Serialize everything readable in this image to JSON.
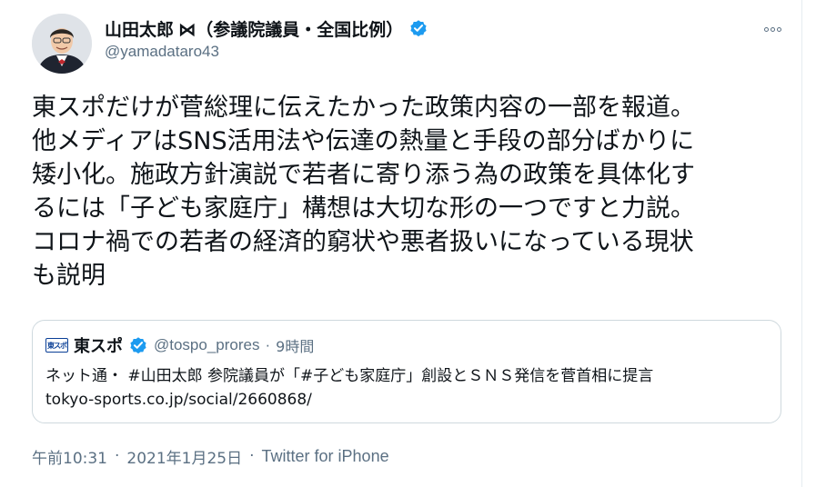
{
  "author": {
    "display_name": "山田太郎 ⋈（参議院議員・全国比例）",
    "handle": "@yamadataro43",
    "verified_icon": "verified-badge-icon",
    "avatar": "avatar-photo"
  },
  "menu": {
    "more_icon": "more-options-icon"
  },
  "tweet": {
    "lines": [
      "東スポだけが菅総理に伝えたかった政策内容の一部を報道。",
      "他メディアはSNS活用法や伝達の熱量と手段の部分ばかりに",
      "矮小化。施政方針演説で若者に寄り添う為の政策を具体化す",
      "るには「子ども家庭庁」構想は大切な形の一つですと力説。",
      "コロナ禍での若者の経済的窮状や悪者扱いになっている現状",
      "も説明"
    ]
  },
  "quote": {
    "logo_text": "東スポ",
    "name": "東スポ",
    "handle": "@tospo_prores",
    "separator": "·",
    "time": "9時間",
    "text_line1": "ネット通・ #山田太郎 参院議員が「#子ども家庭庁」創設とＳＮＳ発信を菅首相に提言",
    "text_line2": "tokyo-sports.co.jp/social/2660868/"
  },
  "meta": {
    "time": "午前10:31",
    "sep1": "·",
    "date": "2021年1月25日",
    "sep2": "·",
    "source": "Twitter for iPhone"
  },
  "colors": {
    "text": "#0f1419",
    "secondary": "#5b7083",
    "verified": "#1d9bf0",
    "border": "#cfd9de"
  }
}
